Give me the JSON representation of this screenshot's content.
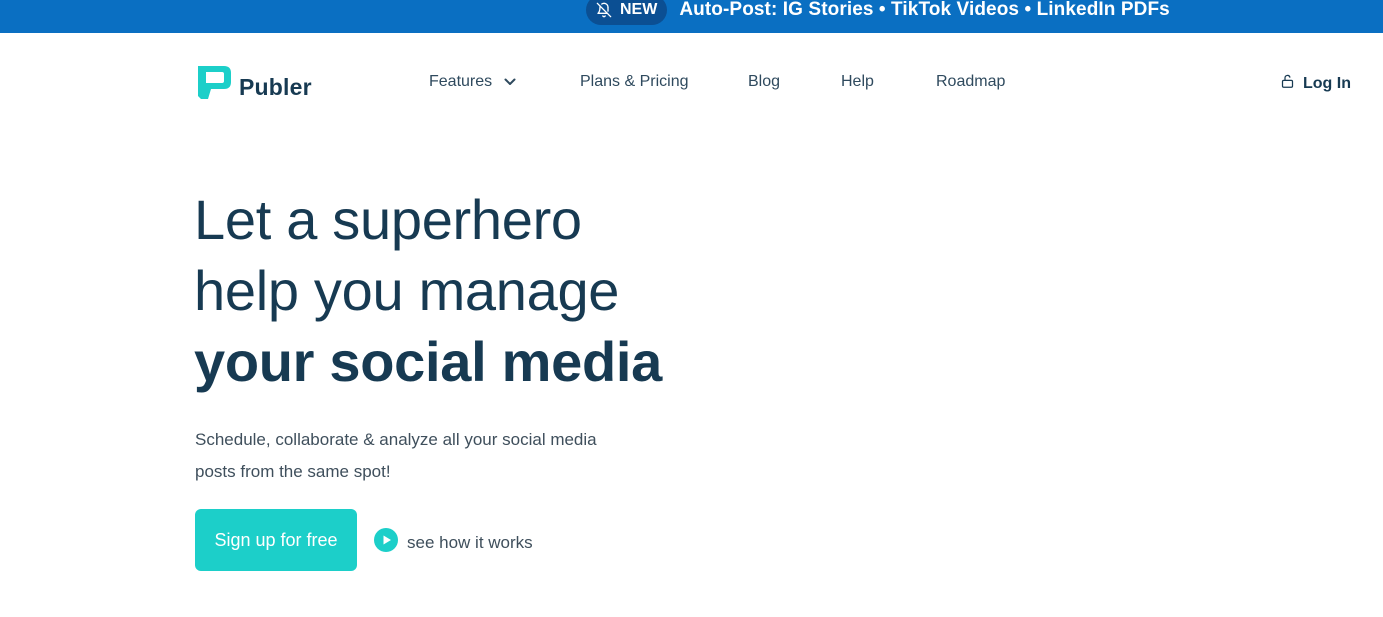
{
  "announcement": {
    "badge": "NEW",
    "text": "Auto-Post: IG Stories • TikTok Videos • LinkedIn PDFs",
    "bell_icon": "bell-off-icon"
  },
  "header": {
    "logo_text": "Publer",
    "nav": [
      {
        "label": "Features",
        "has_dropdown": true
      },
      {
        "label": "Plans & Pricing"
      },
      {
        "label": "Blog"
      },
      {
        "label": "Help"
      },
      {
        "label": "Roadmap"
      }
    ],
    "login_label": "Log In"
  },
  "hero": {
    "title_line1": "Let a superhero",
    "title_line2": "help you manage",
    "title_line3": "your social media",
    "subtitle": "Schedule, collaborate & analyze all your social media posts from the same spot!",
    "cta_label": "Sign up for free",
    "secondary_label": "see how it works"
  },
  "colors": {
    "announce_bg": "#0a6fc2",
    "pill_bg": "#0b4f93",
    "accent": "#1ccfc9",
    "text_dark": "#173a52"
  }
}
